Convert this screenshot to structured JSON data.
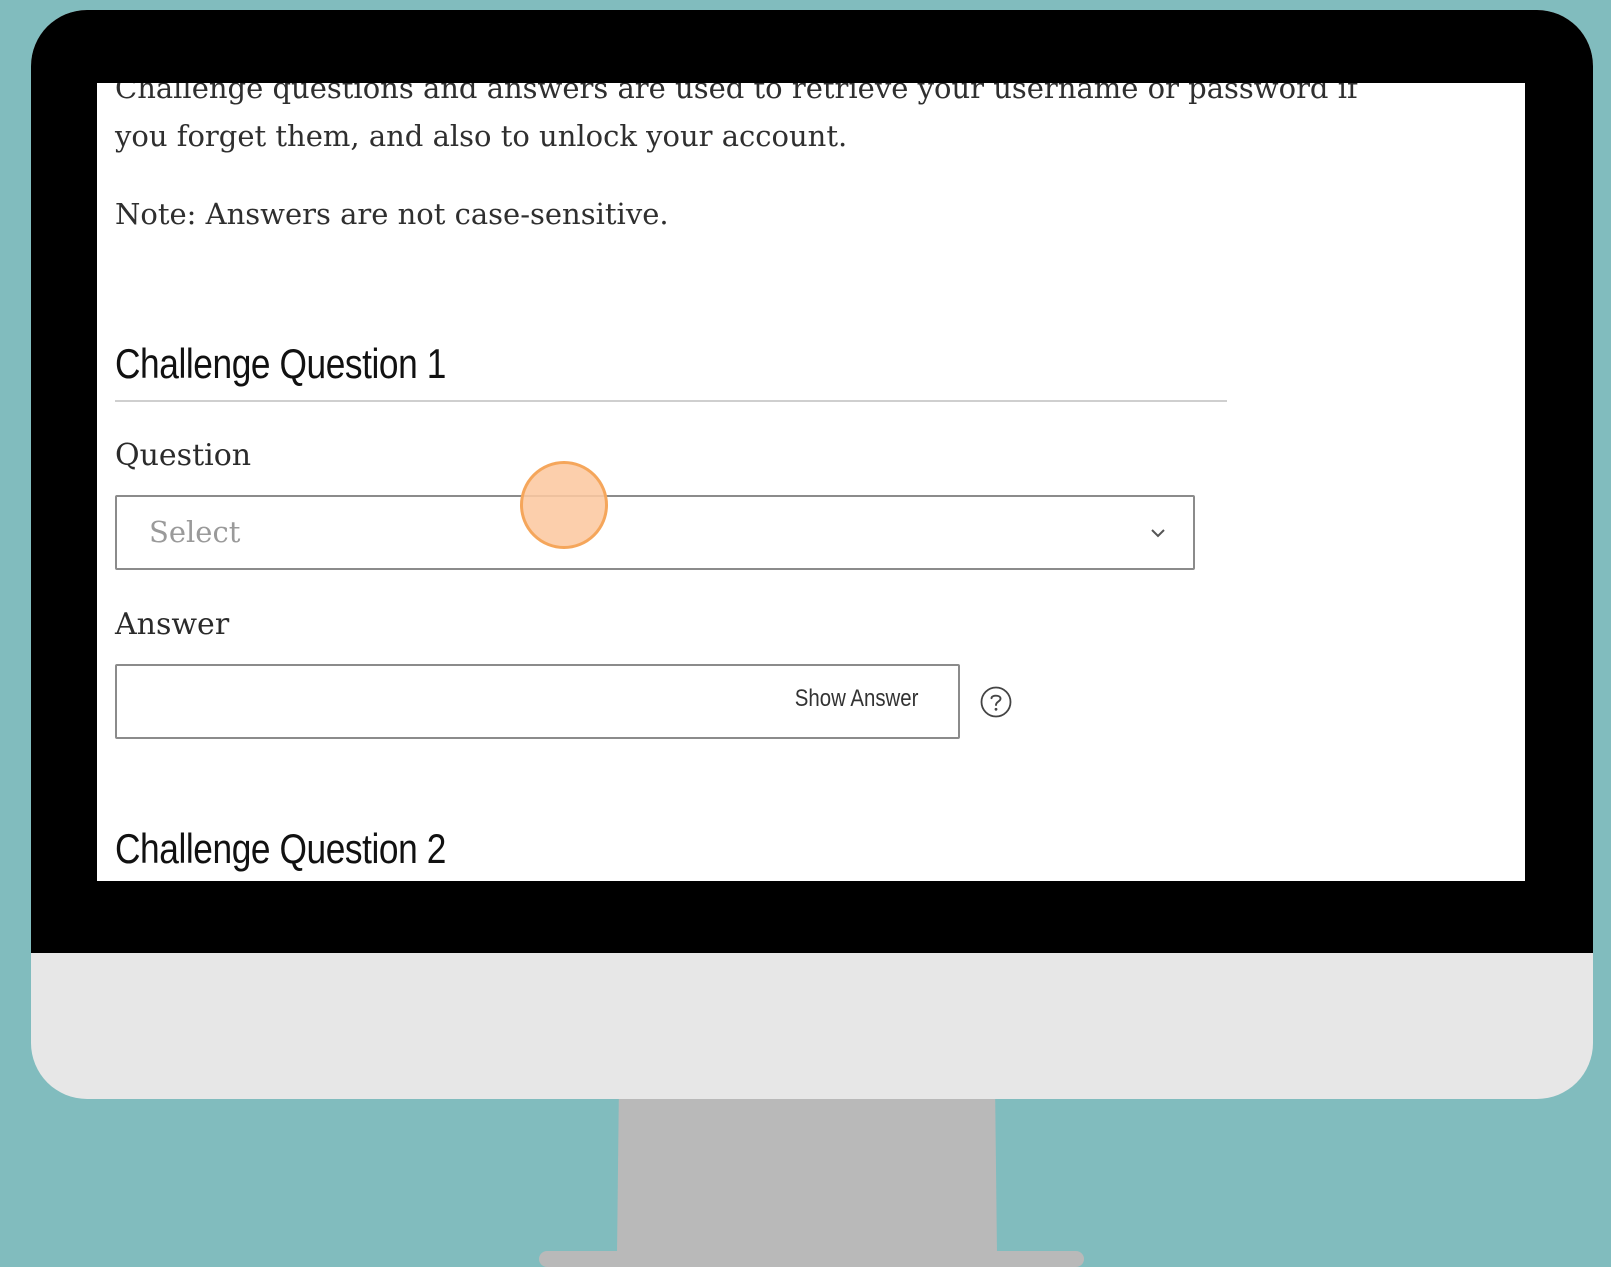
{
  "colors": {
    "background": "#81bcbe",
    "bezel": "#000000",
    "monitor_chin": "#e7e7e7",
    "stand": "#b9b9b9",
    "click_marker": "#f5a65b"
  },
  "page": {
    "intro": "Challenge questions and answers are used to retrieve your username or password if you forget them, and also to unlock your account.",
    "note": "Note: Answers are not case-sensitive."
  },
  "challenge_1": {
    "title": "Challenge Question 1",
    "question_label": "Question",
    "question_placeholder": "Select",
    "answer_label": "Answer",
    "answer_value": "",
    "show_answer_label": "Show Answer",
    "help_icon": "question-circle-icon"
  },
  "challenge_2": {
    "title": "Challenge Question 2"
  }
}
